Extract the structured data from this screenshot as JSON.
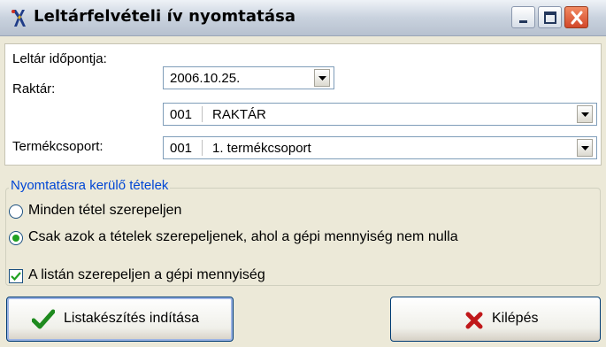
{
  "window": {
    "title": "Leltárfelvételi ív nyomtatása",
    "controls": [
      "minimize",
      "maximize",
      "close"
    ]
  },
  "fields": {
    "date": {
      "label": "Leltár időpontja:",
      "value": "2006.10.25."
    },
    "warehouse": {
      "label": "Raktár:",
      "code": "001",
      "name": "RAKTÁR"
    },
    "product_group": {
      "label": "Termékcsoport:",
      "code": "001",
      "name": "1. termékcsoport"
    }
  },
  "print_items": {
    "legend": "Nyomtatásra kerülő tételek",
    "options": [
      {
        "label": "Minden tétel szerepeljen",
        "selected": false
      },
      {
        "label": "Csak azok a tételek szerepeljenek, ahol a gépi mennyiség nem nulla",
        "selected": true
      }
    ]
  },
  "show_machine_qty": {
    "label": "A listán szerepeljen a gépi mennyiség",
    "checked": true
  },
  "buttons": {
    "start": {
      "label": "Listakészítés indítása",
      "icon": "checkmark-icon"
    },
    "exit": {
      "label": "Kilépés",
      "icon": "red-x-icon"
    }
  },
  "colors": {
    "title_gradient_top": "#eef2f7",
    "legend_text": "#0046d5",
    "radio_dot": "#21a121",
    "close_button": "#d2472a"
  }
}
